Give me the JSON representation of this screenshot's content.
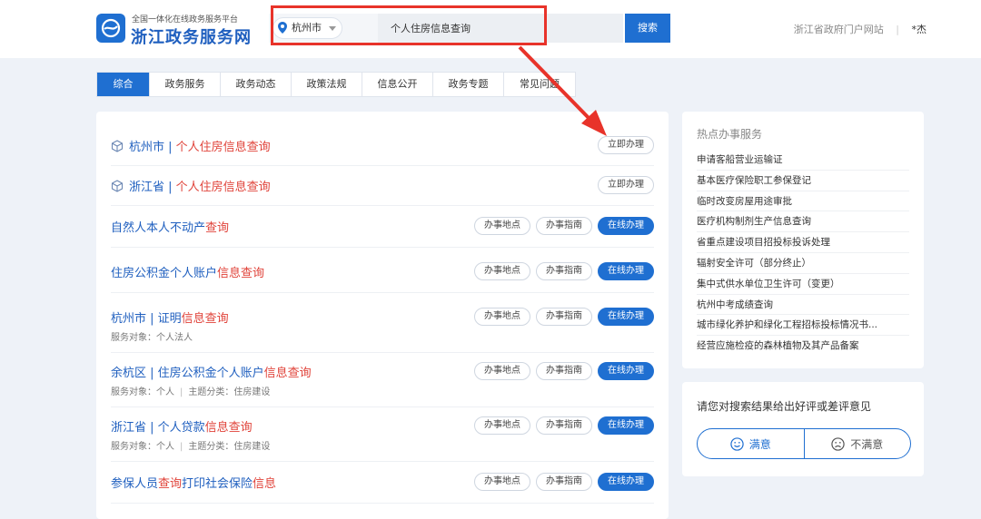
{
  "header": {
    "logo_sub": "全国一体化在线政务服务平台",
    "logo_main": "浙江政务服务网",
    "city": "杭州市",
    "search_value": "个人住房信息查询",
    "search_button": "搜索",
    "portal_link": "浙江省政府门户网站",
    "separator": "|",
    "user": "*杰"
  },
  "tabs": [
    "综合",
    "政务服务",
    "政务动态",
    "政策法规",
    "信息公开",
    "政务专题",
    "常见问题"
  ],
  "results": [
    {
      "prefix": "杭州市 | ",
      "title_red": "个人住房信息查询",
      "suffix": "",
      "button": "立即办理"
    },
    {
      "prefix": "浙江省 | ",
      "title_red": "个人住房信息查询",
      "suffix": "",
      "button": "立即办理"
    },
    {
      "prefix": "自然人本人不动产",
      "title_red": "查询",
      "suffix": ""
    },
    {
      "prefix": "住房公积金个人账户",
      "title_red": "信息查询",
      "suffix": ""
    },
    {
      "prefix": "杭州市 | 证明",
      "title_red": "信息查询",
      "suffix": "",
      "meta1": "服务对象：个人法人"
    },
    {
      "prefix": "余杭区 | 住房公积金个人账户",
      "title_red": "信息查询",
      "suffix": "",
      "meta1": "服务对象：个人",
      "meta2": "主题分类：住房建设"
    },
    {
      "prefix": "浙江省 | 个人贷款",
      "title_red": "信息查询",
      "suffix": "",
      "meta1": "服务对象：个人",
      "meta2": "主题分类：住房建设"
    },
    {
      "prefix": "参保人员",
      "title_red": "查询",
      "suffix": "打印社会保险",
      "suffix_red": "信息"
    }
  ],
  "row_buttons": {
    "location": "办事地点",
    "guide": "办事指南",
    "online": "在线办理"
  },
  "meta_separator": "|",
  "hot": {
    "title": "热点办事服务",
    "items": [
      "申请客船营业运输证",
      "基本医疗保险职工参保登记",
      "临时改变房屋用途审批",
      "医疗机构制剂生产信息查询",
      "省重点建设项目招投标投诉处理",
      "辐射安全许可（部分终止）",
      "集中式供水单位卫生许可（变更）",
      "杭州中考成绩查询",
      "城市绿化养护和绿化工程招标投标情况书...",
      "经营应施检疫的森林植物及其产品备案"
    ]
  },
  "feedback": {
    "title": "请您对搜索结果给出好评或差评意见",
    "good": "满意",
    "bad": "不满意"
  },
  "colors": {
    "accent": "#1f6fd1",
    "highlight": "#e0433a",
    "annotation": "#e8332a"
  }
}
